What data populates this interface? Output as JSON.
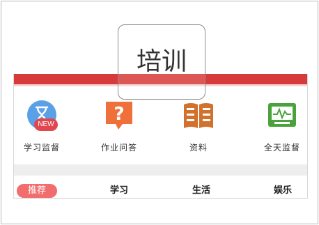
{
  "overlay": {
    "title": "培训"
  },
  "badge": {
    "text": "NEW"
  },
  "menu": [
    {
      "label": "学习监督",
      "icon": "hourglass-icon",
      "color": "#4a90d9"
    },
    {
      "label": "作业问答",
      "icon": "question-icon",
      "color": "#f06b3a"
    },
    {
      "label": "资料",
      "icon": "book-icon",
      "color": "#d2712c"
    },
    {
      "label": "全天监督",
      "icon": "monitor-icon",
      "color": "#4aa33a"
    }
  ],
  "tabs": [
    "推荐",
    "学习",
    "生活",
    "娱乐"
  ],
  "colors": {
    "header_bar": "#d73a3a",
    "active_tab": "#f26d6d",
    "badge": "#e0474f"
  }
}
